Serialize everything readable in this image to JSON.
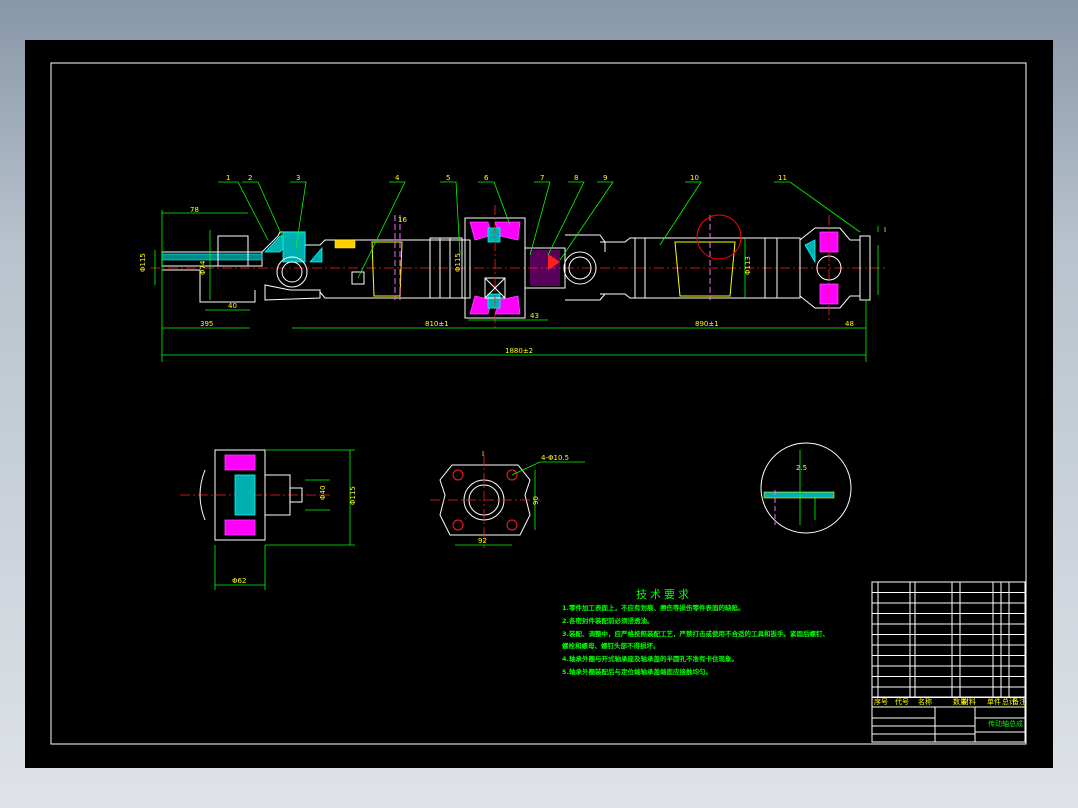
{
  "drawing": {
    "part_balloons": [
      "1",
      "2",
      "3",
      "4",
      "5",
      "6",
      "7",
      "8",
      "9",
      "10",
      "11"
    ],
    "dimensions": {
      "d1": "78",
      "d2": "Φ115",
      "d3": "Φ74",
      "d4": "40",
      "d5": "395",
      "d6": "16",
      "d7": "Φ115",
      "d8": "810±1",
      "d9": "43",
      "d10": "Φ113",
      "d11": "890±1",
      "d12": "48",
      "d13": "1880±2",
      "d14": "Φ40",
      "d15": "Φ115",
      "d16": "Φ62",
      "d17": "90",
      "d18": "92",
      "d19": "4-Φ10.5",
      "d20": "2.5"
    },
    "section_marks": [
      "I",
      "I"
    ],
    "colors": {
      "sheet": "#000000",
      "outline": "#ffffff",
      "dimension": "#00ff00",
      "text": "#ffff00",
      "centerline": "#ff2020",
      "hatch_magenta": "#ff00ff",
      "hatch_cyan": "#00ffff"
    }
  },
  "technical_requirements": {
    "title": "技术要求",
    "notes": [
      "1.零件加工表面上，不应有划痕、擦伤等损伤零件表面的缺陷。",
      "2.各密封件装配前必须浸透油。",
      "3.装配、调整中，应严格按照装配工艺，严禁打击或使用不合适的工具和扳手。紧固后螺钉、",
      "螺栓和螺母、螺钉头部不得损坏。",
      "4.轴承外圈与开式轴承座及轴承盖的半圆孔不准有卡住现象。",
      "5.轴承外圈装配后与定位端轴承盖端面应接触均匀。"
    ]
  },
  "title_block": {
    "header": [
      "序号",
      "代号",
      "名称",
      "数量",
      "材料",
      "单件",
      "总计",
      "备注"
    ],
    "drawing_name": "传动轴总成"
  }
}
